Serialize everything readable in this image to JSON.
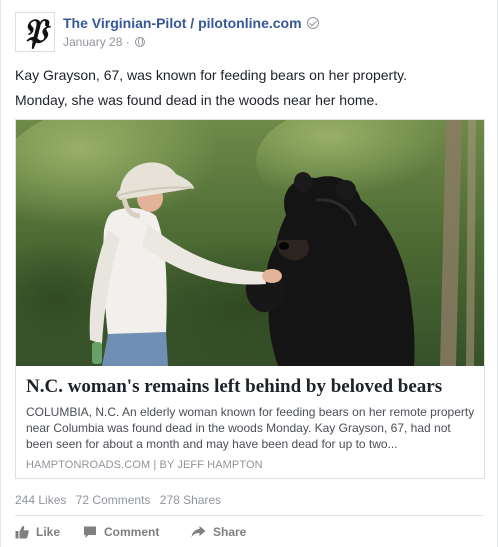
{
  "post": {
    "page_name": "The Virginian-Pilot / pilotonline.com",
    "logo_glyph": "𝔓",
    "date": "January 28",
    "separator": "·",
    "text_line_1": "Kay Grayson, 67, was known for feeding bears on her property.",
    "text_line_2": "Monday, she was found dead in the woods near her home."
  },
  "link": {
    "title": "N.C. woman's remains left behind by beloved bears",
    "description": "COLUMBIA, N.C. An elderly woman known for feeding bears on her remote property near Columbia was found dead in the woods Monday. Kay Grayson, 67, had not been seen for about a month and may have been dead for up to two...",
    "source": "HAMPTONROADS.COM | BY JEFF HAMPTON"
  },
  "stats": {
    "likes": "244 Likes",
    "comments": "72 Comments",
    "shares": "278 Shares"
  },
  "actions": {
    "like": "Like",
    "comment": "Comment",
    "share": "Share"
  },
  "colors": {
    "page_link": "#365899",
    "meta_text": "#90949c",
    "body_text": "#1d2129",
    "action_text": "#7f7f7f"
  },
  "icons": {
    "verified": "verified-check-icon",
    "audience": "globe-icon",
    "like": "thumbs-up-icon",
    "comment": "speech-bubble-icon",
    "share": "share-arrow-icon"
  }
}
